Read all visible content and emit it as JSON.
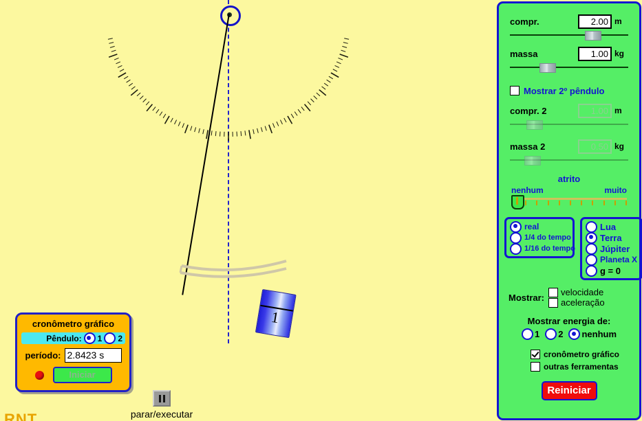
{
  "stage": {
    "pendulum_bob_label": "1",
    "pivot_icon": "pivot-circle-icon",
    "vertical_reference_icon": "dashed-plumb-line",
    "protractor_icon": "protractor-arc-ticks",
    "trail_icon": "swing-trail-arc"
  },
  "chronometer": {
    "title": "cronômetro gráfico",
    "pendulum_label": "Pêndulo:",
    "pendulum_options": [
      "1",
      "2"
    ],
    "pendulum_selected": "1",
    "period_label": "período:",
    "period_value": "2.8423 s",
    "start_label": "Iniciar",
    "led_icon": "red-led-icon"
  },
  "pause": {
    "icon": "pause-icon",
    "label": "parar/executar"
  },
  "corner": {
    "text": "RNT"
  },
  "panel": {
    "length": {
      "label": "compr.",
      "value": "2.00",
      "unit": "m",
      "thumb_pct": 72
    },
    "mass": {
      "label": "massa",
      "value": "1.00",
      "unit": "kg",
      "thumb_pct": 28
    },
    "show_second": {
      "label": "Mostrar 2º pêndulo",
      "checked": false
    },
    "length2": {
      "label": "compr. 2",
      "value": "1.00",
      "unit": "m",
      "thumb_pct": 16
    },
    "mass2": {
      "label": "massa 2",
      "value": "0.50",
      "unit": "kg",
      "thumb_pct": 14
    },
    "friction": {
      "title": "atrito",
      "min_label": "nenhum",
      "max_label": "muito",
      "thumb_pct": 0
    },
    "time_scale": {
      "options": [
        "real",
        "1/4 do tempo",
        "1/16 do tempo"
      ],
      "selected": "real"
    },
    "gravity": {
      "options": [
        "Lua",
        "Terra",
        "Júpiter",
        "Planeta X",
        "g = 0"
      ],
      "selected": "Terra"
    },
    "show": {
      "label": "Mostrar:",
      "velocity": {
        "label": "velocidade",
        "checked": false
      },
      "acceleration": {
        "label": "aceleração",
        "checked": false
      }
    },
    "energy": {
      "title": "Mostrar energia de:",
      "options": [
        "1",
        "2",
        "nenhum"
      ],
      "selected": "nenhum"
    },
    "tools": {
      "chronometer": {
        "label": "cronômetro gráfico",
        "checked": true
      },
      "others": {
        "label": "outras ferramentas",
        "checked": false
      }
    },
    "reset_label": "Reiniciar"
  }
}
